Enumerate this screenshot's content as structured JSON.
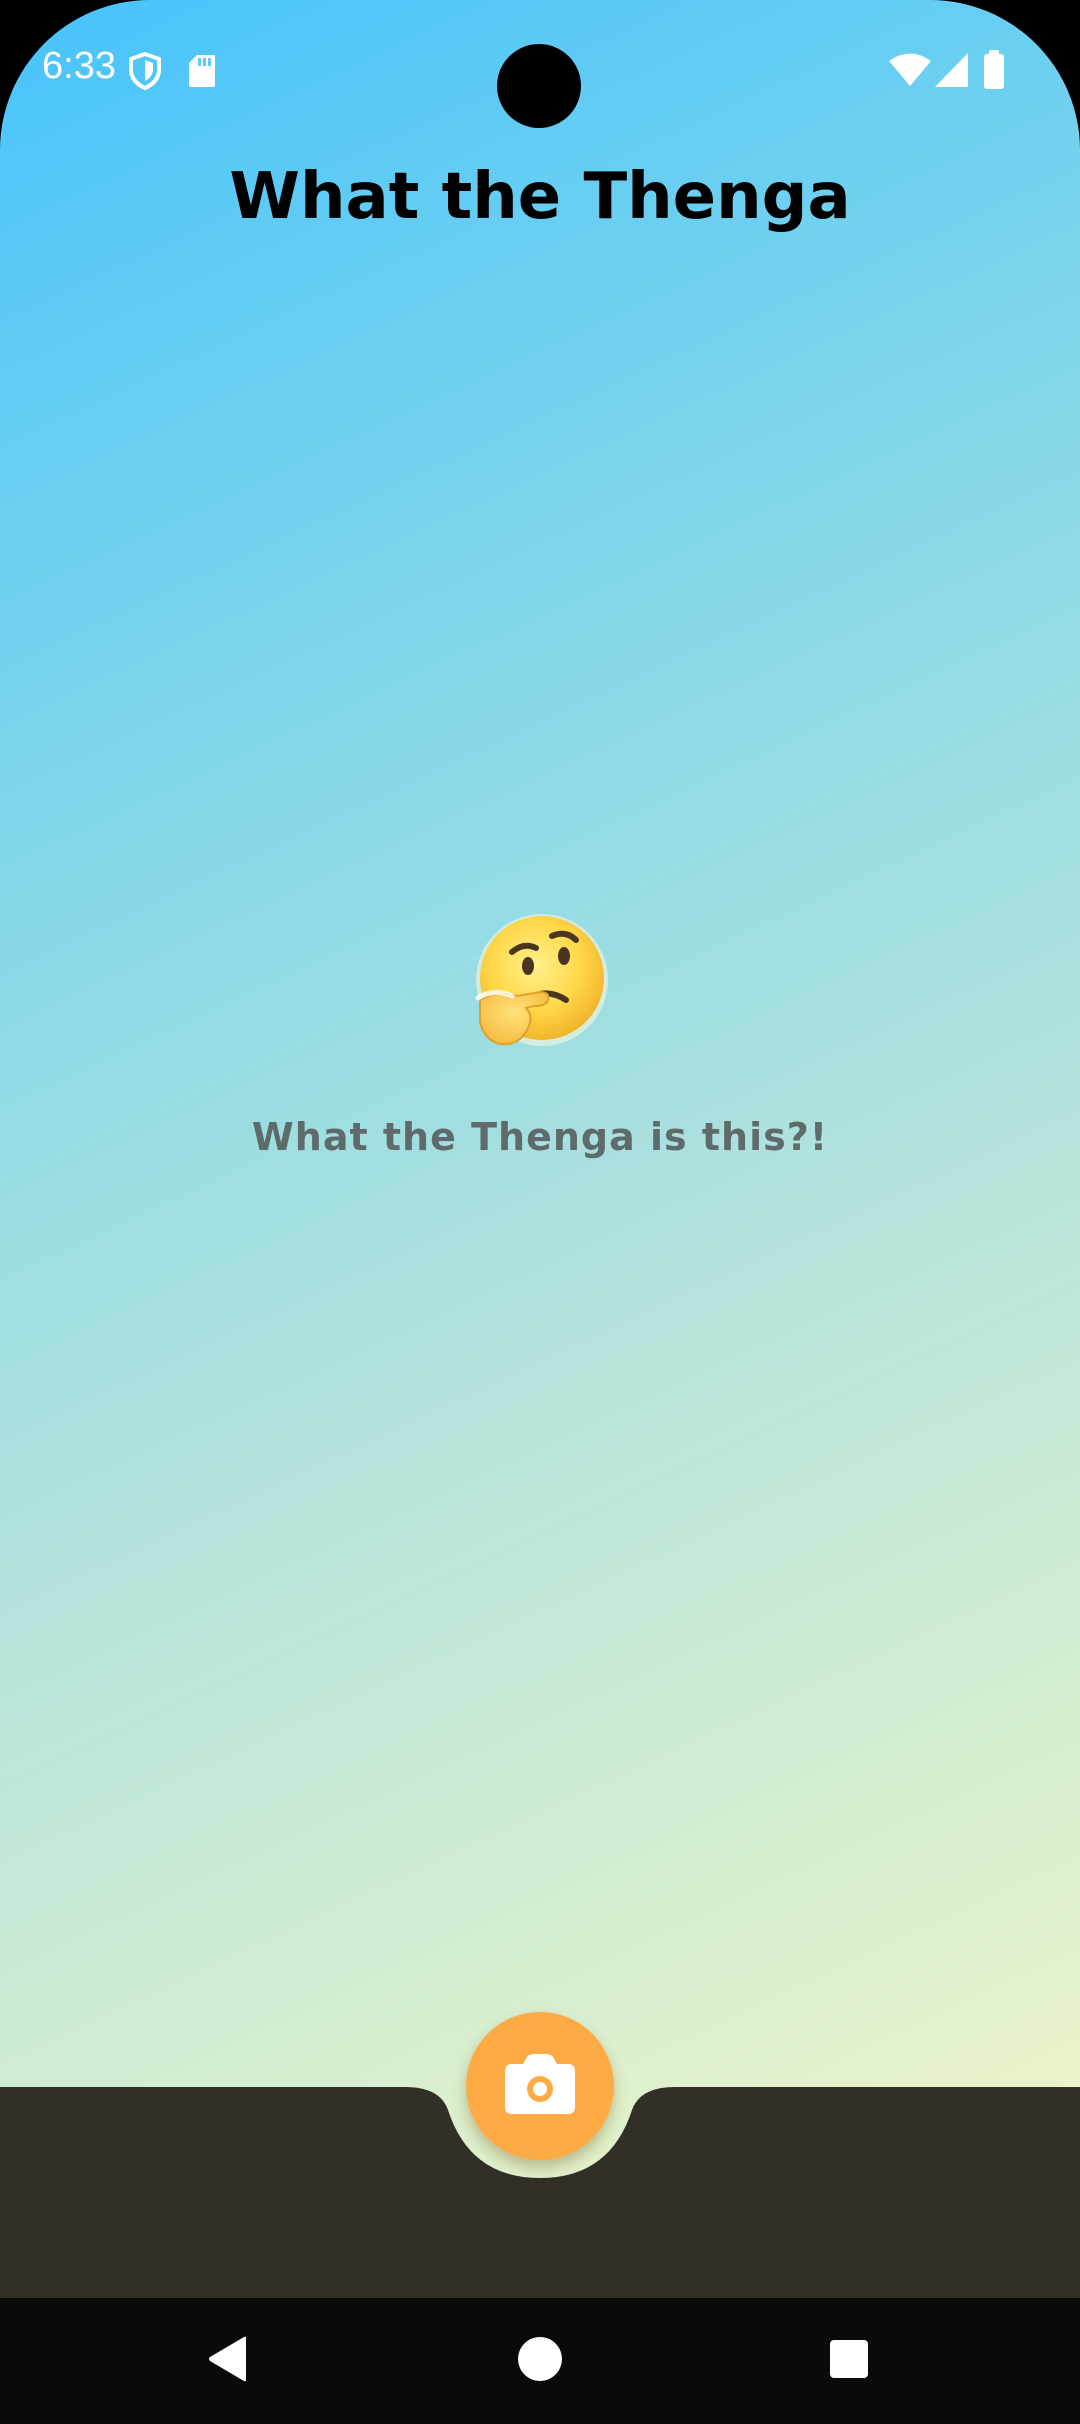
{
  "status_bar": {
    "time": "6:33",
    "icons_left": [
      "shield-icon",
      "sd-card-icon"
    ],
    "icons_right": [
      "wifi-icon",
      "signal-icon",
      "battery-icon"
    ]
  },
  "app": {
    "title": "What the Thenga"
  },
  "main": {
    "emoji_icon": "thinking-face-icon",
    "message": "What the Thenga is this?!"
  },
  "bottom_bar": {
    "fab_icon": "camera-icon",
    "colors": {
      "bar": "#323026",
      "fab": "#ffab45"
    }
  },
  "nav_bar": {
    "buttons": [
      "back-icon",
      "home-icon",
      "recents-icon"
    ]
  },
  "colors": {
    "gradient_top": "#47c3fc",
    "gradient_bottom": "#fdf8c5",
    "title": "#000000",
    "message": "#5f6b6b"
  }
}
